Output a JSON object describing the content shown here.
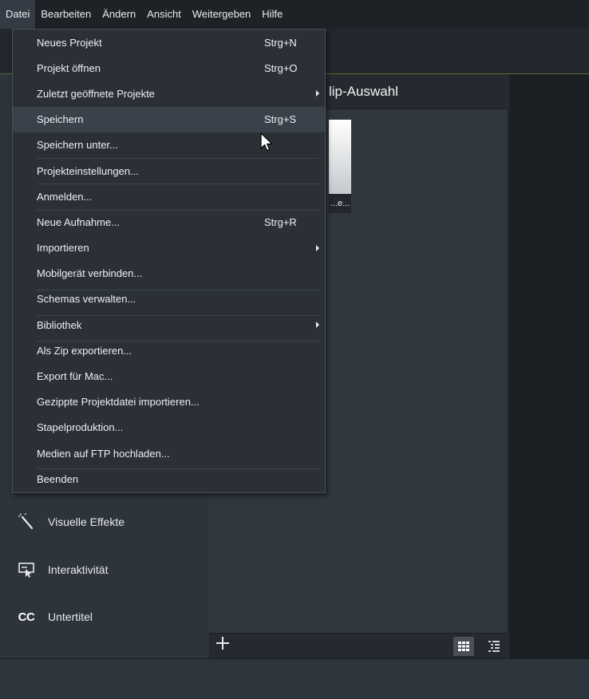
{
  "menubar": {
    "items": [
      "Datei",
      "Bearbeiten",
      "Ändern",
      "Ansicht",
      "Weitergeben",
      "Hilfe"
    ],
    "active_index": 0
  },
  "dropdown": {
    "items": [
      {
        "label": "Neues Projekt",
        "shortcut": "Strg+N"
      },
      {
        "label": "Projekt öffnen",
        "shortcut": "Strg+O"
      },
      {
        "label": "Zuletzt geöffnete Projekte",
        "shortcut": "",
        "submenu": true
      },
      {
        "label": "Speichern",
        "shortcut": "Strg+S",
        "hover": true
      },
      {
        "label": "Speichern unter...",
        "shortcut": ""
      },
      {
        "label": "Projekteinstellungen...",
        "shortcut": ""
      },
      {
        "label": "Anmelden...",
        "shortcut": ""
      },
      {
        "label": "Neue Aufnahme...",
        "shortcut": "Strg+R"
      },
      {
        "label": "Importieren",
        "shortcut": "",
        "submenu": true
      },
      {
        "label": "Mobilgerät verbinden...",
        "shortcut": ""
      },
      {
        "label": "Schemas verwalten...",
        "shortcut": ""
      },
      {
        "label": "Bibliothek",
        "shortcut": "",
        "submenu": true
      },
      {
        "label": "Als Zip exportieren...",
        "shortcut": ""
      },
      {
        "label": "Export für Mac...",
        "shortcut": ""
      },
      {
        "label": "Gezippte Projektdatei importieren...",
        "shortcut": ""
      },
      {
        "label": "Stapelproduktion...",
        "shortcut": ""
      },
      {
        "label": "Medien auf FTP hochladen...",
        "shortcut": ""
      },
      {
        "label": "Beenden",
        "shortcut": ""
      }
    ]
  },
  "sidebar": {
    "items": [
      {
        "label": "Visuelle Effekte",
        "icon": "magic-wand-icon"
      },
      {
        "label": "Interaktivität",
        "icon": "interactive-cursor-icon"
      },
      {
        "label": "Untertitel",
        "icon": "cc-icon",
        "icon_text": "CC"
      }
    ]
  },
  "panel": {
    "title": "lip-Auswahl",
    "thumb_label": "...e..."
  },
  "colors": {
    "menubar_bg": "#1e2227",
    "menu_bg": "#2b3037",
    "menu_hover": "#3a414a",
    "accent_line": "#5a6b2a"
  }
}
